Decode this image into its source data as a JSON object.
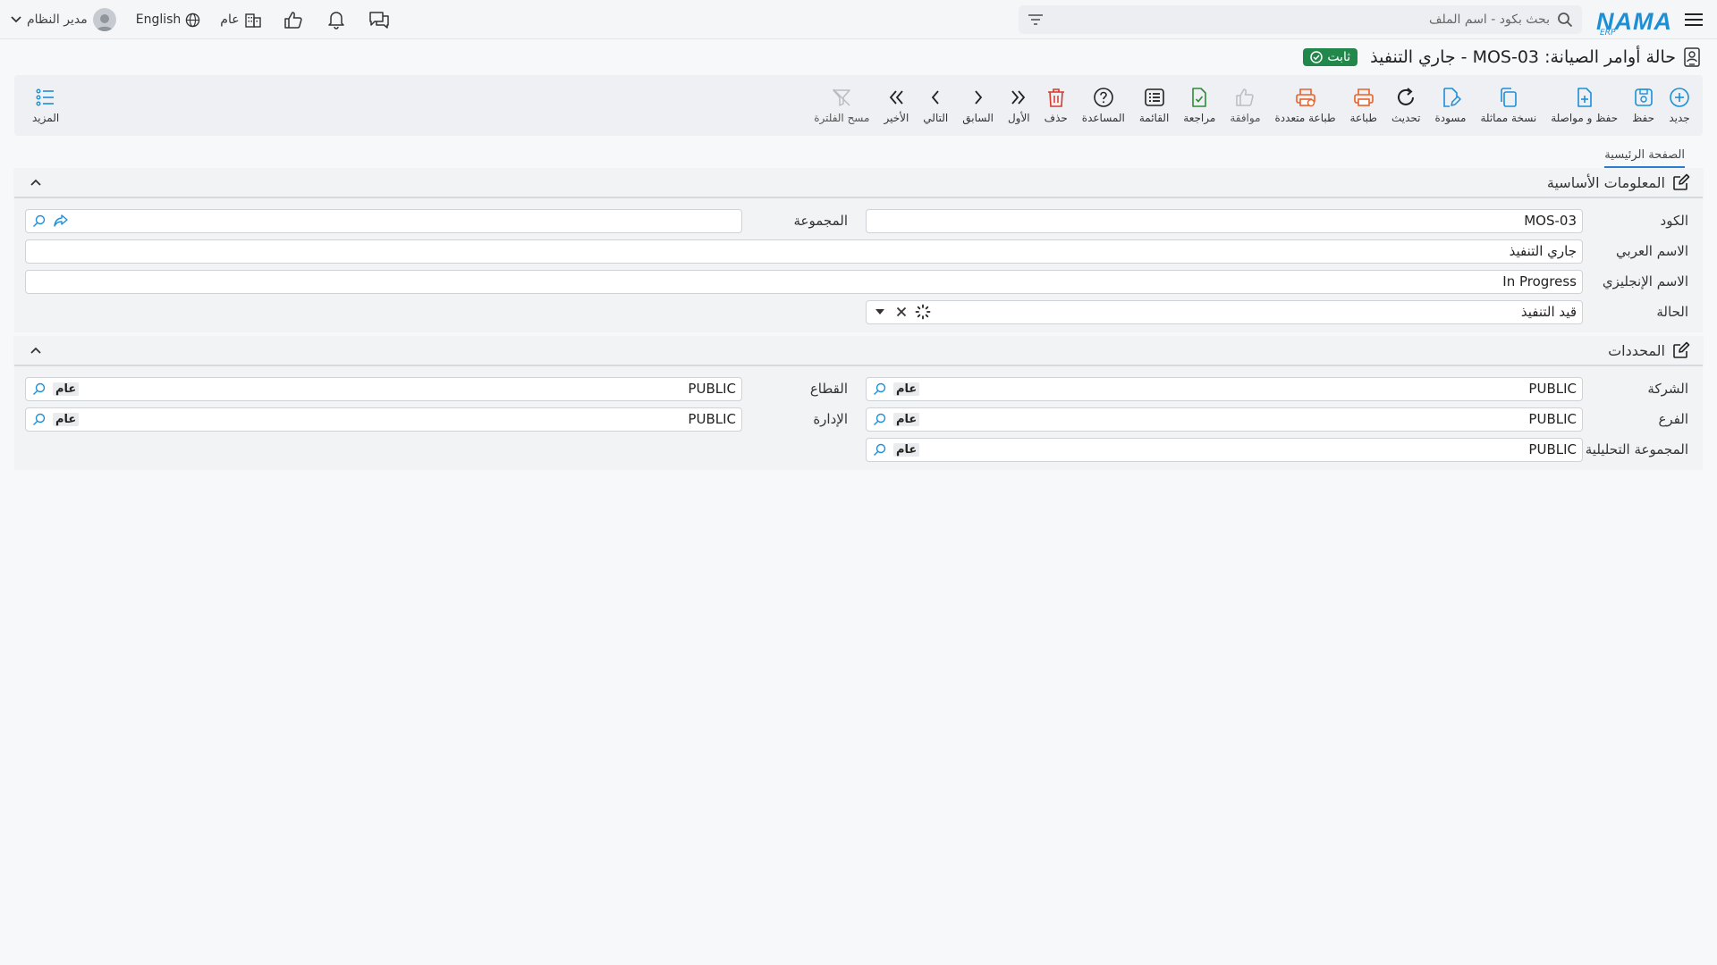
{
  "topbar": {
    "logo_text": "NAMA",
    "logo_sub": "ERP",
    "search_placeholder": "بحث بكود - اسم الملف",
    "company_label": "عام",
    "language_label": "English",
    "user_name": "مدير النظام"
  },
  "title": {
    "text": "حالة أوامر الصيانة: MOS-03 - جاري التنفيذ",
    "status_badge": "ثابت"
  },
  "toolbar": {
    "new": "جديد",
    "save": "حفظ",
    "save_continue": "حفظ و مواصلة",
    "duplicate": "نسخة مماثلة",
    "draft": "مسودة",
    "refresh": "تحديث",
    "print": "طباعة",
    "multi_print": "طباعة متعددة",
    "approve": "موافقة",
    "review": "مراجعة",
    "list": "القائمة",
    "help": "المساعدة",
    "delete": "حذف",
    "first": "الأول",
    "previous": "السابق",
    "next": "التالي",
    "last": "الأخير",
    "clear_filter": "مسح الفلترة",
    "more": "المزيد"
  },
  "tabs": {
    "main": "الصفحة الرئيسية"
  },
  "basic_info": {
    "title": "المعلومات الأساسية",
    "code_label": "الكود",
    "code_value": "MOS-03",
    "group_label": "المجموعة",
    "group_value": "",
    "arabic_name_label": "الاسم العربي",
    "arabic_name_value": "جاري التنفيذ",
    "english_name_label": "الاسم الإنجليزي",
    "english_name_value": "In Progress",
    "status_label": "الحالة",
    "status_value": "قيد التنفيذ"
  },
  "dimensions": {
    "title": "المحددات",
    "company_label": "الشركة",
    "company_value": "PUBLIC",
    "company_chip": "عام",
    "sector_label": "القطاع",
    "sector_value": "PUBLIC",
    "sector_chip": "عام",
    "branch_label": "الفرع",
    "branch_value": "PUBLIC",
    "branch_chip": "عام",
    "department_label": "الإدارة",
    "department_value": "PUBLIC",
    "department_chip": "عام",
    "analysis_group_label": "المجموعة التحليلية",
    "analysis_group_value": "PUBLIC",
    "analysis_group_chip": "عام"
  },
  "colors": {
    "accent": "#1d8fd6",
    "status_green": "#21874a",
    "print_orange": "#e8622c",
    "delete_red": "#d43b2f",
    "review_green": "#2e8b3a"
  }
}
